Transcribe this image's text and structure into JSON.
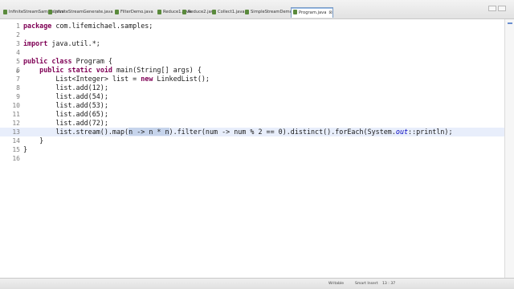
{
  "tabs": [
    {
      "label": "InfiniteStreamSample.java",
      "color": "#5a8a3c"
    },
    {
      "label": "InfiniteStreamGenerate.java",
      "color": "#5a8a3c"
    },
    {
      "label": "FilterDemo.java",
      "color": "#5a8a3c"
    },
    {
      "label": "Reduce1.java",
      "color": "#5a8a3c"
    },
    {
      "label": "Reduce2.java",
      "color": "#5a8a3c"
    },
    {
      "label": "Collect1.java",
      "color": "#5a8a3c"
    },
    {
      "label": "SimpleStreamDemo.java",
      "color": "#5a8a3c"
    },
    {
      "label": "Program.java",
      "color": "#5a8a3c",
      "active": true,
      "close": "⊠"
    }
  ],
  "editor": {
    "lines": [
      {
        "n": "1",
        "t": "package com.lifemichael.samples;"
      },
      {
        "n": "2",
        "t": ""
      },
      {
        "n": "3",
        "t": "import java.util.*;"
      },
      {
        "n": "4",
        "t": ""
      },
      {
        "n": "5",
        "t": "public class Program {"
      },
      {
        "n": "6",
        "t": "    public static void main(String[] args) {",
        "fold": "⊖"
      },
      {
        "n": "7",
        "t": "        List<Integer> list = new LinkedList();"
      },
      {
        "n": "8",
        "t": "        list.add(12);"
      },
      {
        "n": "9",
        "t": "        list.add(54);"
      },
      {
        "n": "10",
        "t": "        list.add(53);"
      },
      {
        "n": "11",
        "t": "        list.add(65);"
      },
      {
        "n": "12",
        "t": "        list.add(72);"
      },
      {
        "n": "13",
        "t": "        list.stream().map(n -> n * n).filter(num -> num % 2 == 0).distinct().forEach(System.out::println);"
      },
      {
        "n": "14",
        "t": "    }"
      },
      {
        "n": "15",
        "t": "}"
      },
      {
        "n": "16",
        "t": ""
      }
    ],
    "current_line": "13",
    "selection": "n -> n * n"
  },
  "status": {
    "writable": "Writable",
    "insert_mode": "Smart Insert",
    "position": "13 : 37"
  },
  "colors": {
    "keyword": "#7f0055",
    "field": "#0000c0",
    "current_line": "#e8eefb",
    "selection": "#c6d4ec"
  }
}
